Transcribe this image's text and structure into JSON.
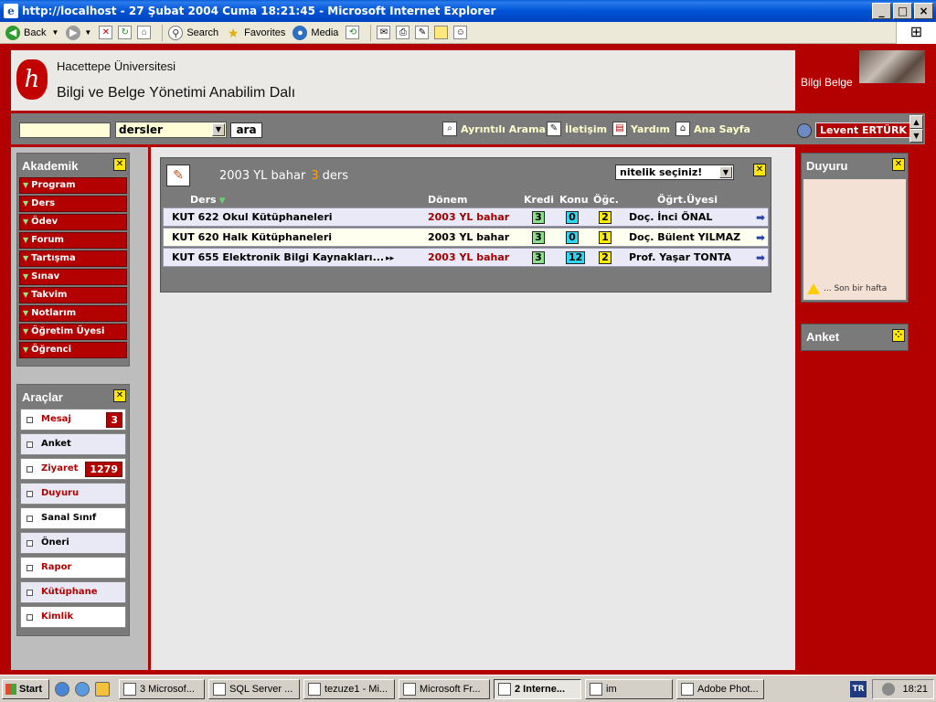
{
  "window": {
    "title": "http://localhost - 27 Şubat 2004 Cuma 18:21:45 - Microsoft Internet Explorer",
    "app_icon": "e",
    "buttons": [
      "_",
      "□",
      "×"
    ]
  },
  "ie_toolbar": {
    "back": "Back",
    "search": "Search",
    "favorites": "Favorites",
    "media": "Media"
  },
  "header": {
    "university": "Hacettepe Üniversitesi",
    "department": "Bilgi ve Belge Yönetimi Anabilim Dalı",
    "site_name": "Bilgi Belge",
    "logo_glyph": "h"
  },
  "navbar": {
    "search_value": "",
    "category_selected": "dersler",
    "go_label": "ara",
    "links": [
      {
        "label": "Ayrıntılı Arama",
        "icon": "search-doc-icon"
      },
      {
        "label": "İletişim",
        "icon": "contact-icon"
      },
      {
        "label": "Yardım",
        "icon": "help-book-icon"
      },
      {
        "label": "Ana Sayfa",
        "icon": "home-icon"
      }
    ],
    "user": "Levent ERTÜRK"
  },
  "akademik": {
    "title": "Akademik",
    "items": [
      "Program",
      "Ders",
      "Ödev",
      "Forum",
      "Tartışma",
      "Sınav",
      "Takvim",
      "Notlarım",
      "Öğretim Üyesi",
      "Öğrenci"
    ]
  },
  "araclar": {
    "title": "Araçlar",
    "items": [
      {
        "label": "Mesaj",
        "count": "3",
        "color": "#b30000"
      },
      {
        "label": "Anket",
        "count": "",
        "color": "#000000"
      },
      {
        "label": "Ziyaret",
        "count": "1279",
        "color": "#b30000"
      },
      {
        "label": "Duyuru",
        "count": "",
        "color": "#b30000"
      },
      {
        "label": "Sanal Sınıf",
        "count": "",
        "color": "#000000"
      },
      {
        "label": "Öneri",
        "count": "",
        "color": "#000000"
      },
      {
        "label": "Rapor",
        "count": "",
        "color": "#b30000"
      },
      {
        "label": "Kütüphane",
        "count": "",
        "color": "#b30000"
      },
      {
        "label": "Kimlik",
        "count": "",
        "color": "#b30000"
      }
    ]
  },
  "courses": {
    "term_label": "2003 YL bahar",
    "count": "3",
    "count_word": "ders",
    "filter_selected": "nitelik seçiniz!",
    "columns": {
      "course": "Ders",
      "term": "Dönem",
      "credit": "Kredi",
      "topic": "Konu",
      "student": "Öğc.",
      "teacher": "Öğrt.Üyesi"
    },
    "rows": [
      {
        "name": "KUT 622 Okul Kütüphaneleri",
        "term": "2003 YL bahar",
        "term_color": "#a00000",
        "credit": "3",
        "topic": "0",
        "student": "2",
        "teacher": "Doç. İnci ÖNAL"
      },
      {
        "name": "KUT 620 Halk Kütüphaneleri",
        "term": "2003 YL bahar",
        "term_color": "#000000",
        "credit": "3",
        "topic": "0",
        "student": "1",
        "teacher": "Doç. Bülent YILMAZ"
      },
      {
        "name": "KUT 655 Elektronik Bilgi Kaynakları...",
        "term": "2003 YL bahar",
        "term_color": "#a00000",
        "credit": "3",
        "topic": "12",
        "student": "2",
        "teacher": "Prof. Yaşar TONTA"
      }
    ]
  },
  "duyuru": {
    "title": "Duyuru",
    "text": "... Son bir hafta"
  },
  "anket": {
    "title": "Anket"
  },
  "taskbar": {
    "start": "Start",
    "tasks": [
      {
        "label": "3 Microsof...",
        "active": false
      },
      {
        "label": "SQL Server ...",
        "active": false
      },
      {
        "label": "tezuze1 - Mi...",
        "active": false
      },
      {
        "label": "Microsoft Fr...",
        "active": false
      },
      {
        "label": "2 Interne...",
        "active": true
      },
      {
        "label": "im",
        "active": false
      },
      {
        "label": "Adobe Phot...",
        "active": false
      }
    ],
    "lang": "TR",
    "clock": "18:21"
  }
}
